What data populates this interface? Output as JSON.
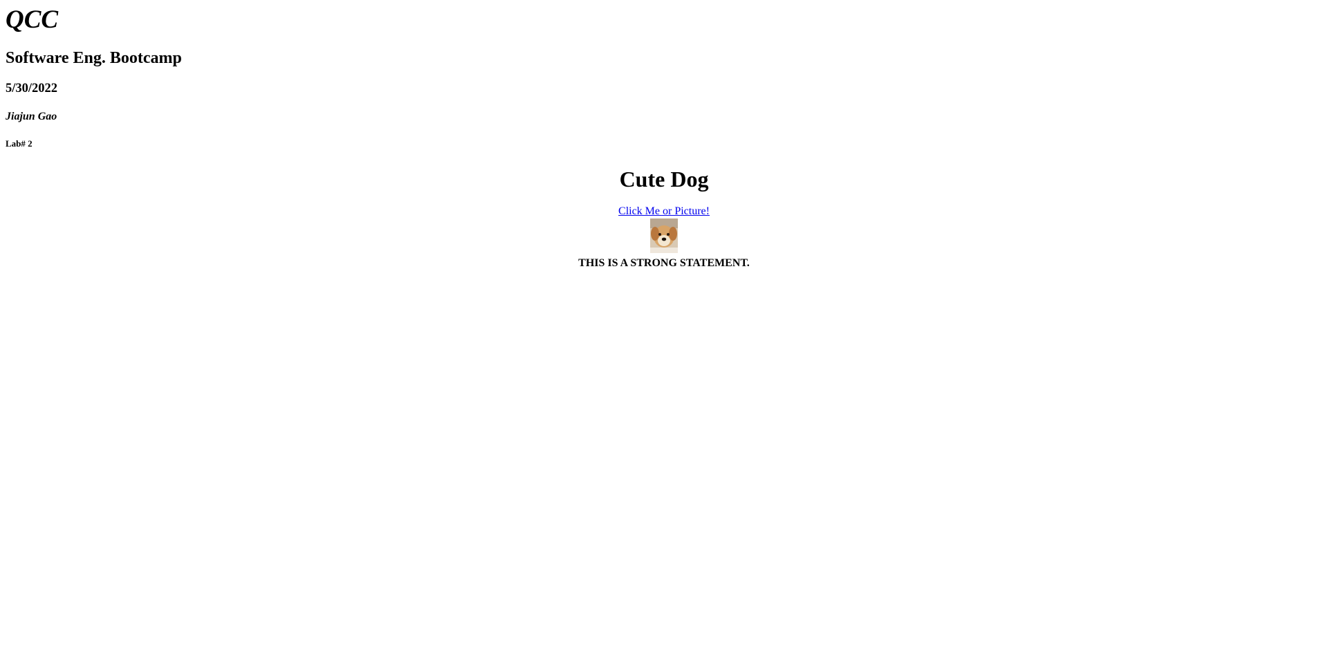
{
  "header": {
    "school": "QCC",
    "course": "Software Eng. Bootcamp",
    "date": "5/30/2022",
    "author": "Jiajun Gao",
    "lab": "Lab# 2"
  },
  "main": {
    "title": "Cute Dog",
    "link_text": "Click Me or Picture!",
    "image_subject": "golden dog puppy photo",
    "strong_statement": "THIS IS A STRONG STATEMENT."
  },
  "colors": {
    "link": "#0000ee",
    "text": "#000000",
    "background": "#ffffff"
  }
}
